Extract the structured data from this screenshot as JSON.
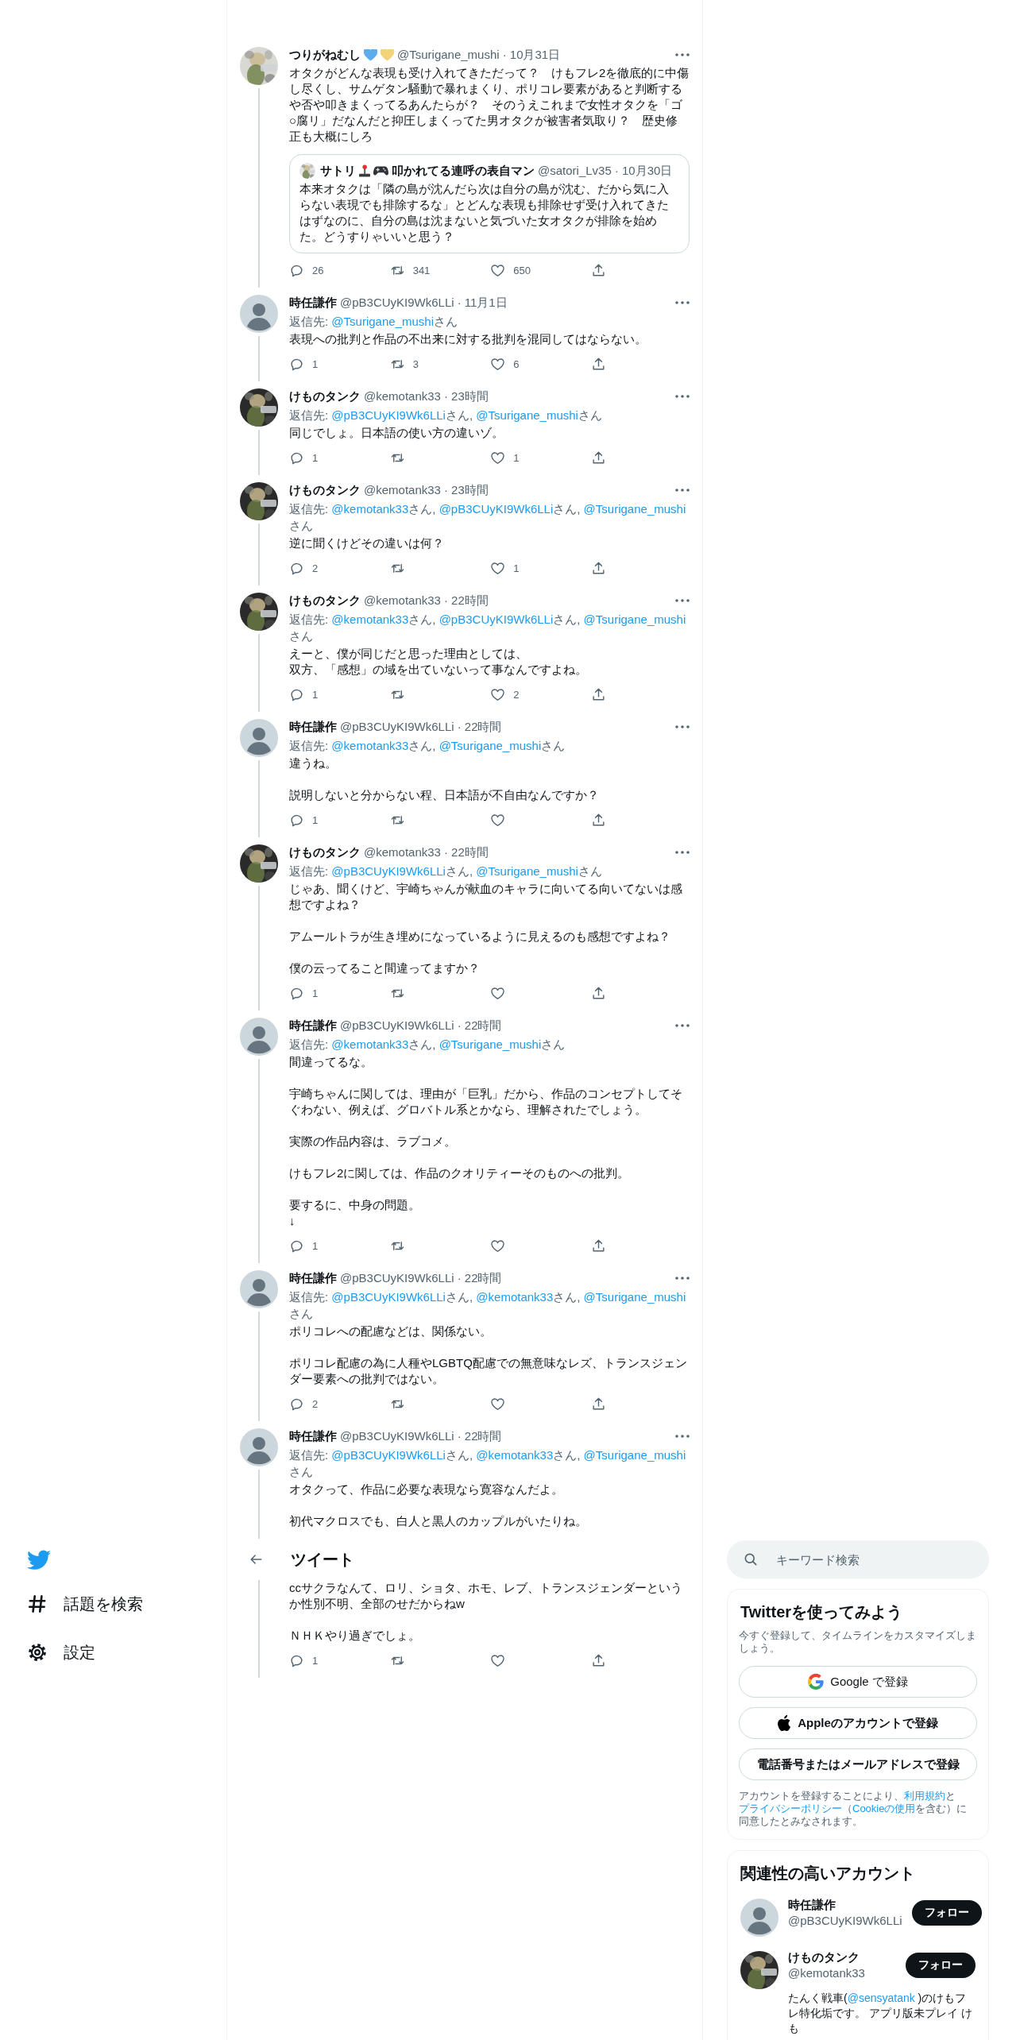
{
  "thread": [
    {
      "name": "つりがねむし",
      "name_icons": [
        {
          "kind": "heart",
          "color": "#5dadec"
        },
        {
          "kind": "heart",
          "color": "#f4d27a"
        }
      ],
      "handle": "@Tsurigane_mushi",
      "time": "· 10月31日",
      "avatar": {
        "kind": "picture",
        "color": "#d9d9d4"
      },
      "paragraphs": [
        [
          "オタクがどんな表現も受け入れてきただって？　けもフレ2を徹底的に中傷し尽くし、サムゲタン騒動で暴れまくり、ポリコレ要素があると判断するや否や叩きまくってるあんたらが？　そのうえこれまで女性オタクを「ゴ○腐リ」だなんだと抑圧しまくってた男オタクが被害者気取り？　歴史修正も大概にしろ"
        ]
      ],
      "quote": {
        "name": "サトリ",
        "name_icons": [
          {
            "kind": "joystick"
          },
          {
            "kind": "gamepad"
          }
        ],
        "name_after": "叩かれてる連呼の表自マン",
        "handle": "@satori_Lv35",
        "time": "· 10月30日",
        "avatar": {
          "kind": "picture",
          "color": "#e6e6e6"
        },
        "paragraphs": [
          [
            "本来オタクは「隣の島が沈んだら次は自分の島が沈む、だから気に入らない表現でも排除するな」とどんな表現も排除せず受け入れてきたはずなのに、自分の島は沈まないと気づいた女オタクが排除を始めた。どうすりゃいいと思う？"
          ]
        ]
      },
      "actions": {
        "reply": "26",
        "retweet": "341",
        "like": "650"
      }
    },
    {
      "name": "時任謙作",
      "handle": "@pB3CUyKI9Wk6LLi",
      "time": "· 11月1日",
      "avatar": {
        "kind": "default"
      },
      "reply_label": "返信先:",
      "reply_to": [
        {
          "handle": "@Tsurigane_mushi",
          "suffix": "さん"
        }
      ],
      "paragraphs": [
        [
          "表現への批判と作品の不出来に対する批判を混同してはならない。"
        ]
      ],
      "actions": {
        "reply": "1",
        "retweet": "3",
        "like": "6"
      }
    },
    {
      "name": "けものタンク",
      "handle": "@kemotank33",
      "time": "· 23時間",
      "avatar": {
        "kind": "picture",
        "color": "#2a2a2a"
      },
      "reply_label": "返信先:",
      "reply_to": [
        {
          "handle": "@pB3CUyKI9Wk6LLi",
          "suffix": "さん,"
        },
        {
          "handle": "@Tsurigane_mushi",
          "suffix": "さん"
        }
      ],
      "paragraphs": [
        [
          "同じでしょ。日本語の使い方の違いゾ。"
        ]
      ],
      "actions": {
        "reply": "1",
        "like": "1"
      }
    },
    {
      "name": "けものタンク",
      "handle": "@kemotank33",
      "time": "· 23時間",
      "avatar": {
        "kind": "picture",
        "color": "#2a2a2a"
      },
      "reply_label": "返信先:",
      "reply_to": [
        {
          "handle": "@kemotank33",
          "suffix": "さん,"
        },
        {
          "handle": "@pB3CUyKI9Wk6LLi",
          "suffix": "さん,"
        },
        {
          "handle": "@Tsurigane_mushi",
          "suffix": "さん"
        }
      ],
      "paragraphs": [
        [
          "逆に聞くけどその違いは何？"
        ]
      ],
      "actions": {
        "reply": "2",
        "like": "1"
      }
    },
    {
      "name": "けものタンク",
      "handle": "@kemotank33",
      "time": "· 22時間",
      "avatar": {
        "kind": "picture",
        "color": "#2a2a2a"
      },
      "reply_label": "返信先:",
      "reply_to": [
        {
          "handle": "@kemotank33",
          "suffix": "さん,"
        },
        {
          "handle": "@pB3CUyKI9Wk6LLi",
          "suffix": "さん,"
        },
        {
          "handle": "@Tsurigane_mushi",
          "suffix": "さん"
        }
      ],
      "paragraphs": [
        [
          "えーと、僕が同じだと思った理由としては、",
          "双方、「感想」の域を出ていないって事なんですよね。"
        ]
      ],
      "actions": {
        "reply": "1",
        "like": "2"
      }
    },
    {
      "name": "時任謙作",
      "handle": "@pB3CUyKI9Wk6LLi",
      "time": "· 22時間",
      "avatar": {
        "kind": "default"
      },
      "reply_label": "返信先:",
      "reply_to": [
        {
          "handle": "@kemotank33",
          "suffix": "さん,"
        },
        {
          "handle": "@Tsurigane_mushi",
          "suffix": "さん"
        }
      ],
      "paragraphs": [
        [
          "違うね。"
        ],
        [
          "説明しないと分からない程、日本語が不自由なんですか？"
        ]
      ],
      "actions": {
        "reply": "1"
      }
    },
    {
      "name": "けものタンク",
      "handle": "@kemotank33",
      "time": "· 22時間",
      "avatar": {
        "kind": "picture",
        "color": "#2a2a2a"
      },
      "reply_label": "返信先:",
      "reply_to": [
        {
          "handle": "@pB3CUyKI9Wk6LLi",
          "suffix": "さん,"
        },
        {
          "handle": "@Tsurigane_mushi",
          "suffix": "さん"
        }
      ],
      "paragraphs": [
        [
          "じゃあ、聞くけど、宇崎ちゃんが献血のキャラに向いてる向いてないは感想ですよね？"
        ],
        [
          "アムールトラが生き埋めになっているように見えるのも感想ですよね？"
        ],
        [
          "僕の云ってること間違ってますか？"
        ]
      ],
      "actions": {
        "reply": "1"
      }
    },
    {
      "name": "時任謙作",
      "handle": "@pB3CUyKI9Wk6LLi",
      "time": "· 22時間",
      "avatar": {
        "kind": "default"
      },
      "reply_label": "返信先:",
      "reply_to": [
        {
          "handle": "@kemotank33",
          "suffix": "さん,"
        },
        {
          "handle": "@Tsurigane_mushi",
          "suffix": "さん"
        }
      ],
      "paragraphs": [
        [
          "間違ってるな。"
        ],
        [
          "宇崎ちゃんに関しては、理由が「巨乳」だから、作品のコンセプトしてそぐわない、例えば、グロバトル系とかなら、理解されたでしょう。"
        ],
        [
          "実際の作品内容は、ラブコメ。"
        ],
        [
          "けもフレ2に関しては、作品のクオリティーそのものへの批判。"
        ],
        [
          "要するに、中身の問題。",
          "↓"
        ]
      ],
      "actions": {
        "reply": "1"
      }
    },
    {
      "name": "時任謙作",
      "handle": "@pB3CUyKI9Wk6LLi",
      "time": "· 22時間",
      "avatar": {
        "kind": "default"
      },
      "reply_label": "返信先:",
      "reply_to": [
        {
          "handle": "@pB3CUyKI9Wk6LLi",
          "suffix": "さん,"
        },
        {
          "handle": "@kemotank33",
          "suffix": "さん,"
        },
        {
          "handle": "@Tsurigane_mushi",
          "suffix": "さん"
        }
      ],
      "paragraphs": [
        [
          "ポリコレへの配慮などは、関係ない。"
        ],
        [
          "ポリコレ配慮の為に人種やLGBTQ配慮での無意味なレズ、トランスジェンダー要素への批判ではない。"
        ]
      ],
      "actions": {
        "reply": "2"
      }
    },
    {
      "name": "時任謙作",
      "handle": "@pB3CUyKI9Wk6LLi",
      "time": "· 22時間",
      "avatar": {
        "kind": "default"
      },
      "reply_label": "返信先:",
      "reply_to": [
        {
          "handle": "@pB3CUyKI9Wk6LLi",
          "suffix": "さん,"
        },
        {
          "handle": "@kemotank33",
          "suffix": "さん,"
        },
        {
          "handle": "@Tsurigane_mushi",
          "suffix": "さん"
        }
      ],
      "paragraphs": [
        [
          "オタクって、作品に必要な表現なら寛容なんだよ。"
        ],
        [
          "初代マクロスでも、白人と黒人のカップルがいたりね。"
        ]
      ]
    }
  ],
  "nav": {
    "items": [
      {
        "kind": "explore",
        "label": "話題を検索"
      },
      {
        "kind": "settings",
        "label": "設定"
      }
    ]
  },
  "header": {
    "title": "ツイート"
  },
  "thread_continued": {
    "paragraphs": [
      [
        "ccサクラなんて、ロリ、ショタ、ホモ、レブ、トランスジェンダーというか性別不明、全部のせだからねw"
      ],
      [
        "ＮＨＫやり過ぎでしょ。"
      ]
    ],
    "actions": {
      "reply": "1"
    }
  },
  "search": {
    "placeholder": "キーワード検索"
  },
  "signup": {
    "title": "Twitterを使ってみよう",
    "subtitle": "今すぐ登録して、タイムラインをカスタマイズしましょう。",
    "buttons": [
      {
        "kind": "google",
        "label": "Google で登録"
      },
      {
        "kind": "apple",
        "label": "Appleのアカウントで登録"
      },
      {
        "kind": "plain",
        "label": "電話番号またはメールアドレスで登録"
      }
    ],
    "legal": [
      {
        "text": "アカウントを登録することにより、"
      },
      {
        "text": "利用規約",
        "link": true
      },
      {
        "text": "と"
      },
      {
        "text": "プライバシーポリシー",
        "link": true
      },
      {
        "text": "（"
      },
      {
        "text": "Cookieの使用",
        "link": true
      },
      {
        "text": "を含む）に同意したとみなされます。"
      }
    ]
  },
  "related": {
    "title": "関連性の高いアカウント",
    "accounts": [
      {
        "name": "時任謙作",
        "handle": "@pB3CUyKI9Wk6LLi",
        "avatar": {
          "kind": "default"
        },
        "follow": "フォロー"
      },
      {
        "name": "けものタンク",
        "handle": "@kemotank33",
        "avatar": {
          "kind": "picture",
          "color": "#2a2a2a"
        },
        "follow": "フォロー",
        "bio": [
          {
            "text": "たんく戦車("
          },
          {
            "text": "@sensyatank",
            "link": true
          },
          {
            "text": " )のけもフレ特化垢です。 アプリ版未プレイ けも"
          }
        ]
      }
    ]
  }
}
